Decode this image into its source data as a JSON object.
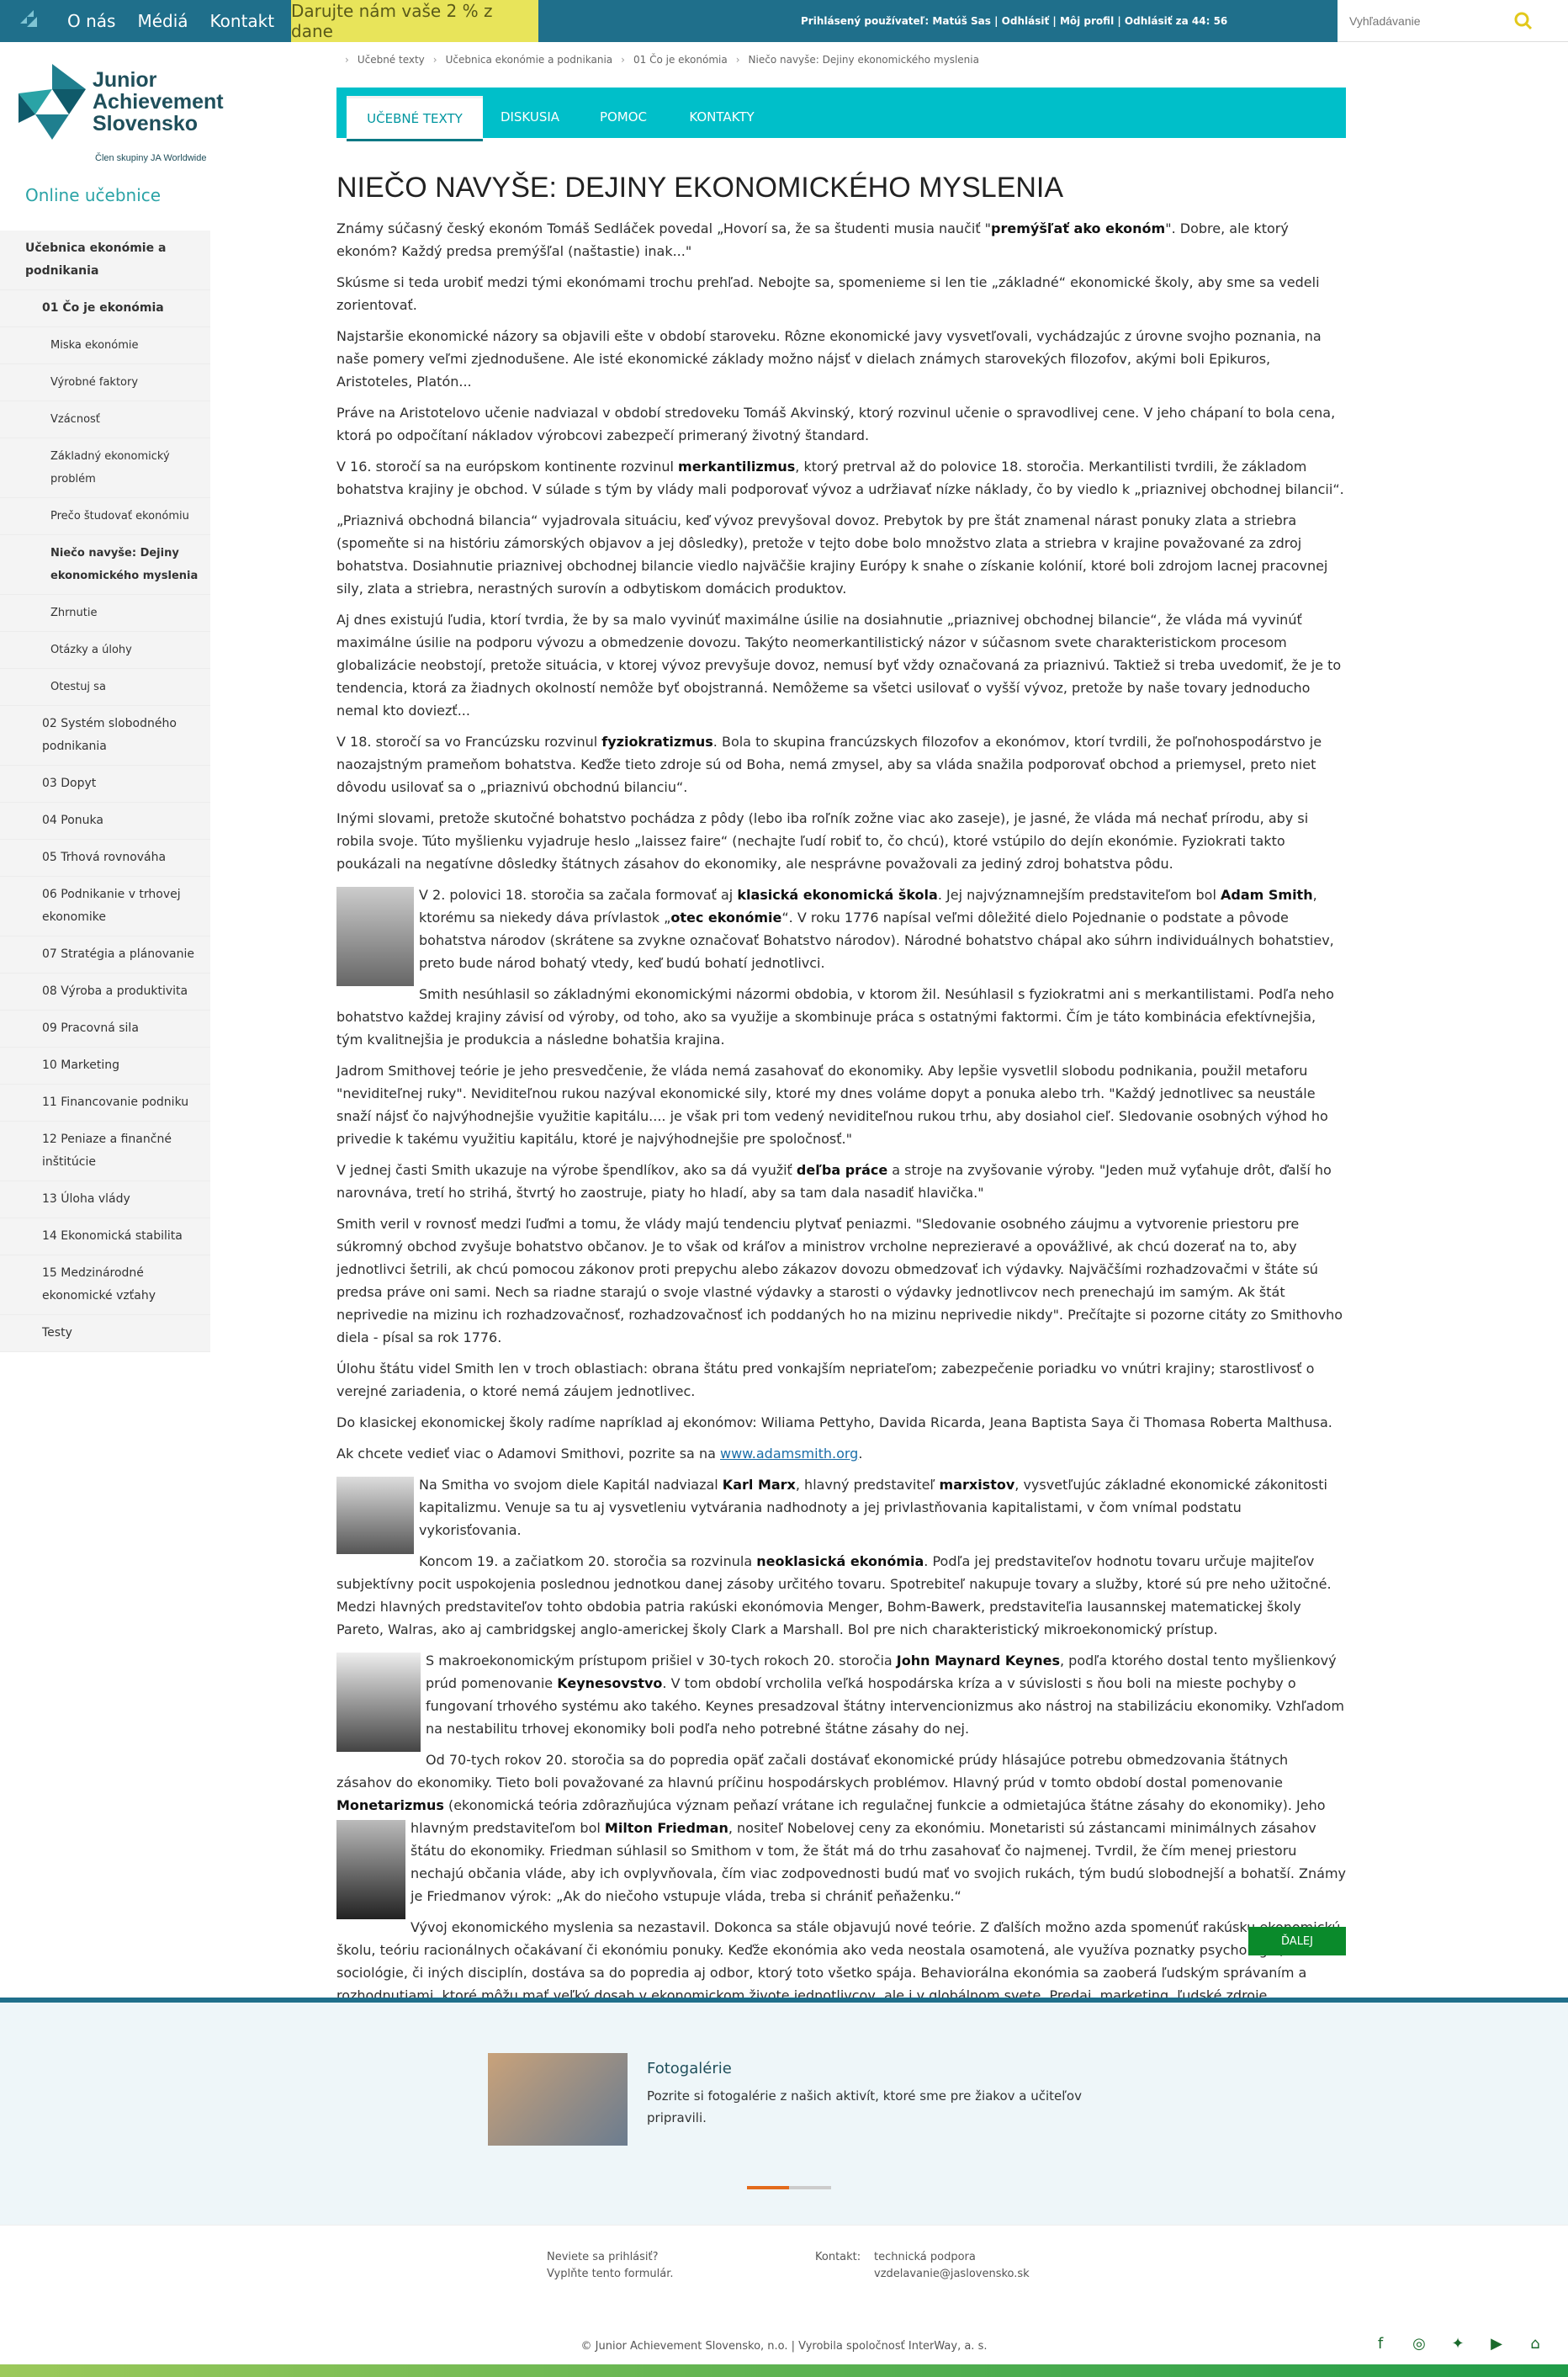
{
  "topbar": {
    "links": [
      "O nás",
      "Médiá",
      "Kontakt"
    ],
    "donate": "Darujte nám vaše 2 % z dane",
    "user": "Prihlásený používateľ: Matúš Sas | Odhlásiť | Môj profil | Odhlásiť za 44: 56",
    "search_placeholder": "Vyhľadávanie"
  },
  "brand": {
    "name1": "Junior",
    "name2": "Achievement",
    "name3": "Slovensko",
    "member": "Člen skupiny JA Worldwide",
    "online": "Online učebnice"
  },
  "sidebar": {
    "items": [
      {
        "label": "Učebnica ekonómie a podnikania",
        "level": "l0"
      },
      {
        "label": "01 Čo je ekonómia",
        "level": "l1b"
      },
      {
        "label": "Miska ekonómie",
        "level": "l2"
      },
      {
        "label": "Výrobné faktory",
        "level": "l2"
      },
      {
        "label": "Vzácnosť",
        "level": "l2"
      },
      {
        "label": "Základný ekonomický problém",
        "level": "l2"
      },
      {
        "label": "Prečo študovať ekonómiu",
        "level": "l2"
      },
      {
        "label": "Niečo navyše: Dejiny ekonomického myslenia",
        "level": "l2b"
      },
      {
        "label": "Zhrnutie",
        "level": "l2"
      },
      {
        "label": "Otázky a úlohy",
        "level": "l2"
      },
      {
        "label": "Otestuj sa",
        "level": "l2"
      },
      {
        "label": "02 Systém slobodného podnikania",
        "level": "l1"
      },
      {
        "label": "03 Dopyt",
        "level": "l1"
      },
      {
        "label": "04 Ponuka",
        "level": "l1"
      },
      {
        "label": "05 Trhová rovnováha",
        "level": "l1"
      },
      {
        "label": "06 Podnikanie v trhovej ekonomike",
        "level": "l1"
      },
      {
        "label": "07 Stratégia a plánovanie",
        "level": "l1"
      },
      {
        "label": "08 Výroba a produktivita",
        "level": "l1"
      },
      {
        "label": "09 Pracovná sila",
        "level": "l1"
      },
      {
        "label": "10 Marketing",
        "level": "l1"
      },
      {
        "label": "11 Financovanie podniku",
        "level": "l1"
      },
      {
        "label": "12 Peniaze a finančné inštitúcie",
        "level": "l1"
      },
      {
        "label": "13 Úloha vlády",
        "level": "l1"
      },
      {
        "label": "14 Ekonomická stabilita",
        "level": "l1"
      },
      {
        "label": "15 Medzinárodné ekonomické vzťahy",
        "level": "l1"
      },
      {
        "label": "Testy",
        "level": "l1"
      }
    ]
  },
  "breadcrumb": [
    "Učebné texty",
    "Učebnica ekonómie a podnikania",
    "01 Čo je ekonómia",
    "Niečo navyše: Dejiny ekonomického myslenia"
  ],
  "tabs": [
    "UČEBNÉ TEXTY",
    "DISKUSIA",
    "POMOC",
    "KONTAKTY"
  ],
  "article": {
    "title": "NIEČO NAVYŠE: DEJINY EKONOMICKÉHO MYSLENIA",
    "next": "ĎALEJ"
  },
  "gallery": {
    "title": "Fotogalérie",
    "text": "Pozrite si fotogalérie z našich aktivít, ktoré sme pre žiakov a učiteľov pripravili."
  },
  "footer": {
    "q1": "Neviete sa prihlásiť?",
    "q2": "Vyplňte tento formulár.",
    "contact_label": "Kontakt:",
    "contact1": "technická podpora",
    "contact2": "vzdelavanie@jaslovensko.sk",
    "copyright": "© Junior Achievement Slovensko, n.o. | Vyrobila spoločnosť InterWay, a. s."
  }
}
